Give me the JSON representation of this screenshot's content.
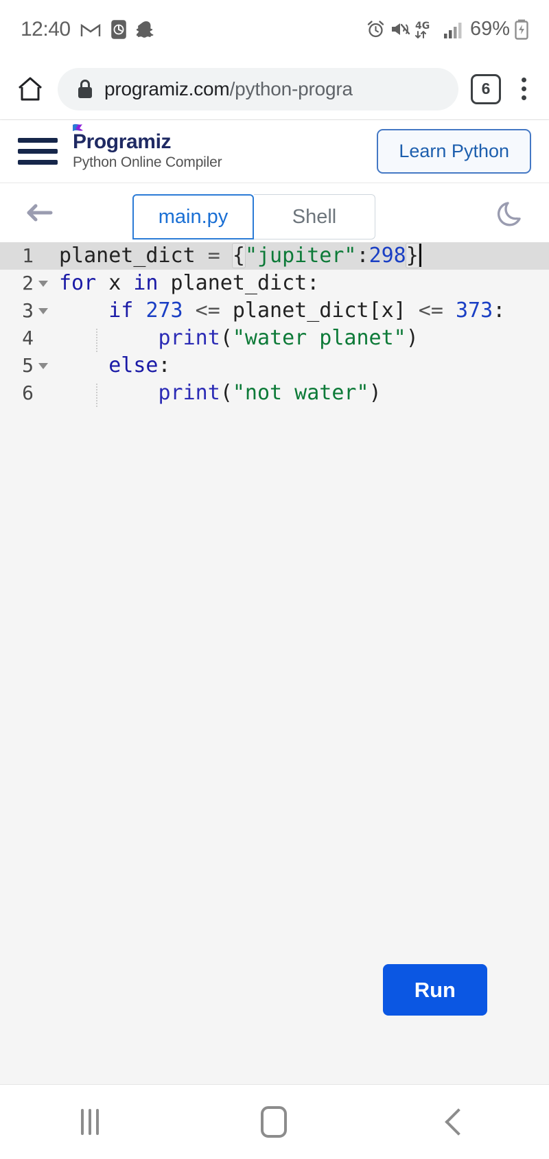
{
  "status_bar": {
    "time": "12:40",
    "battery_percent": "69%",
    "network": "4G",
    "left_icons": [
      "gmail-icon",
      "clock-app-icon",
      "snapchat-icon"
    ],
    "right_icons": [
      "alarm-icon",
      "vibrate-mute-icon",
      "network-4g-icon",
      "signal-bars-icon",
      "battery-charging-icon"
    ]
  },
  "browser": {
    "home_icon": "home-icon",
    "lock_icon": "lock-icon",
    "url_domain": "programiz.com",
    "url_path": "/python-progra",
    "tab_count": "6",
    "menu_icon": "kebab-menu-icon"
  },
  "site_header": {
    "menu_icon": "hamburger-menu-icon",
    "brand_name": "Programiz",
    "subtitle": "Python Online Compiler",
    "cta_label": "Learn Python",
    "brand_color": "#1f2a63",
    "accent_color": "#8e23d9"
  },
  "tab_bar": {
    "back_icon": "back-arrow-icon",
    "tabs": [
      {
        "label": "main.py",
        "active": true
      },
      {
        "label": "Shell",
        "active": false
      }
    ],
    "theme_toggle_icon": "moon-icon",
    "active_tab_color": "#1a6fd4",
    "inactive_tab_color": "#6d757c"
  },
  "editor": {
    "active_line": 1,
    "cursor_line": 1,
    "lines": [
      {
        "number": "1",
        "foldable": false
      },
      {
        "number": "2",
        "foldable": true
      },
      {
        "number": "3",
        "foldable": true
      },
      {
        "number": "4",
        "foldable": false
      },
      {
        "number": "5",
        "foldable": true
      },
      {
        "number": "6",
        "foldable": false
      }
    ],
    "code": {
      "l1_name": "planet_dict ",
      "l1_eq": "= ",
      "l1_open": "{",
      "l1_str": "\"jupiter\"",
      "l1_colon": ":",
      "l1_num": "298",
      "l1_close": "}",
      "l2_kw_for": "for",
      "l2_var": " x ",
      "l2_kw_in": "in",
      "l2_rest": " planet_dict:",
      "l3_indent": "    ",
      "l3_kw_if": "if ",
      "l3_n1": "273",
      "l3_op1": " <= ",
      "l3_expr": "planet_dict[x]",
      "l3_op2": " <= ",
      "l3_n2": "373",
      "l3_colon": ":",
      "l4_indent": "        ",
      "l4_fn": "print",
      "l4_open": "(",
      "l4_str": "\"water planet\"",
      "l4_close": ")",
      "l5_indent": "    ",
      "l5_kw": "else",
      "l5_colon": ":",
      "l6_indent": "        ",
      "l6_fn": "print",
      "l6_open": "(",
      "l6_str": "\"not water\"",
      "l6_close": ")"
    },
    "run_label": "Run",
    "run_color": "#0b57e3"
  },
  "android_nav": {
    "recent_icon": "recent-apps-icon",
    "home_icon": "home-button-icon",
    "back_icon": "back-button-icon"
  }
}
